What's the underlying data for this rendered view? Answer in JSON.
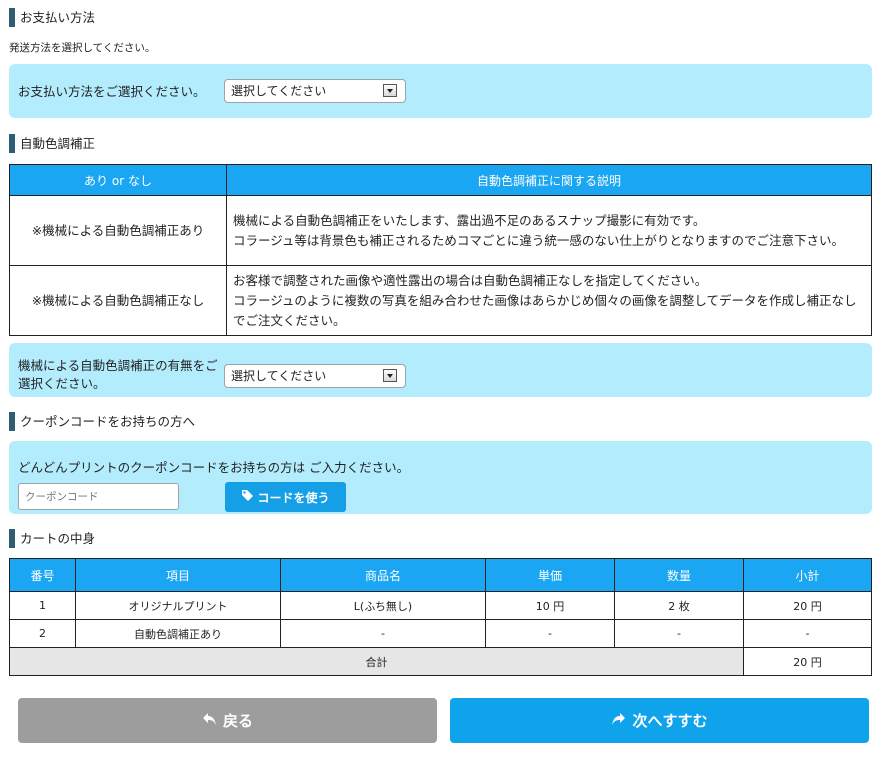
{
  "payment": {
    "heading": "お支払い方法",
    "note": "発送方法を選択してください。",
    "label": "お支払い方法をご選択ください。",
    "select_value": "選択してください"
  },
  "color_correction": {
    "heading": "自動色調補正",
    "table_headers": [
      "あり or なし",
      "自動色調補正に関する説明"
    ],
    "rows": [
      {
        "option": "※機械による自動色調補正あり",
        "desc1": "機械による自動色調補正をいたします、露出過不足のあるスナップ撮影に有効です。",
        "desc2": "コラージュ等は背景色も補正されるためコマごとに違う統一感のない仕上がりとなりますのでご注意下さい。"
      },
      {
        "option": "※機械による自動色調補正なし",
        "desc1": "お客様で調整された画像や適性露出の場合は自動色調補正なしを指定してください。",
        "desc2": "コラージュのように複数の写真を組み合わせた画像はあらかじめ個々の画像を調整してデータを作成し補正なしでご注文ください。"
      }
    ],
    "label": "機械による自動色調補正の有無をご選択ください。",
    "select_value": "選択してください"
  },
  "coupon": {
    "heading": "クーポンコードをお持ちの方へ",
    "text": "どんどんプリントのクーポンコードをお持ちの方は ご入力ください。",
    "placeholder": "クーポンコード",
    "button": "コードを使う"
  },
  "cart": {
    "heading": "カートの中身",
    "headers": [
      "番号",
      "項目",
      "商品名",
      "単価",
      "数量",
      "小計"
    ],
    "rows": [
      [
        "1",
        "オリジナルプリント",
        "L(ふち無し)",
        "10 円",
        "2 枚",
        "20 円"
      ],
      [
        "2",
        "自動色調補正あり",
        "-",
        "-",
        "-",
        "-"
      ]
    ],
    "total_label": "合計",
    "total_value": "20 円"
  },
  "nav": {
    "back": "戻る",
    "next": "次へすすむ"
  },
  "colors": {
    "accent": "#1aa6f2",
    "panel": "#b3ecfc",
    "back_button": "#9d9d9d",
    "next_button": "#0fa3ec"
  }
}
